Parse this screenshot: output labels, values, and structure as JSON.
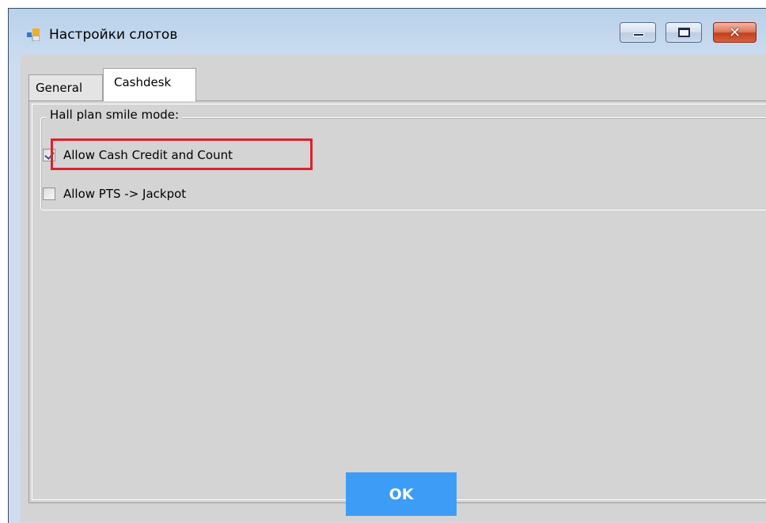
{
  "window": {
    "title": "Настройки слотов",
    "controls": {
      "minimize": "minimize",
      "maximize": "maximize",
      "close": "✕"
    }
  },
  "tabs": [
    {
      "label": "General",
      "active": false
    },
    {
      "label": "Cashdesk",
      "active": true
    }
  ],
  "group": {
    "title": "Hall plan smile mode:",
    "options": [
      {
        "label": "Allow Cash Credit and Count",
        "checked": true
      },
      {
        "label": "Allow PTS -> Jackpot",
        "checked": false
      }
    ]
  },
  "footer": {
    "ok_label": "OK"
  },
  "colors": {
    "ok_button": "#3d9df6",
    "highlight": "#e0202a",
    "client_bg": "#d4d4d4"
  }
}
